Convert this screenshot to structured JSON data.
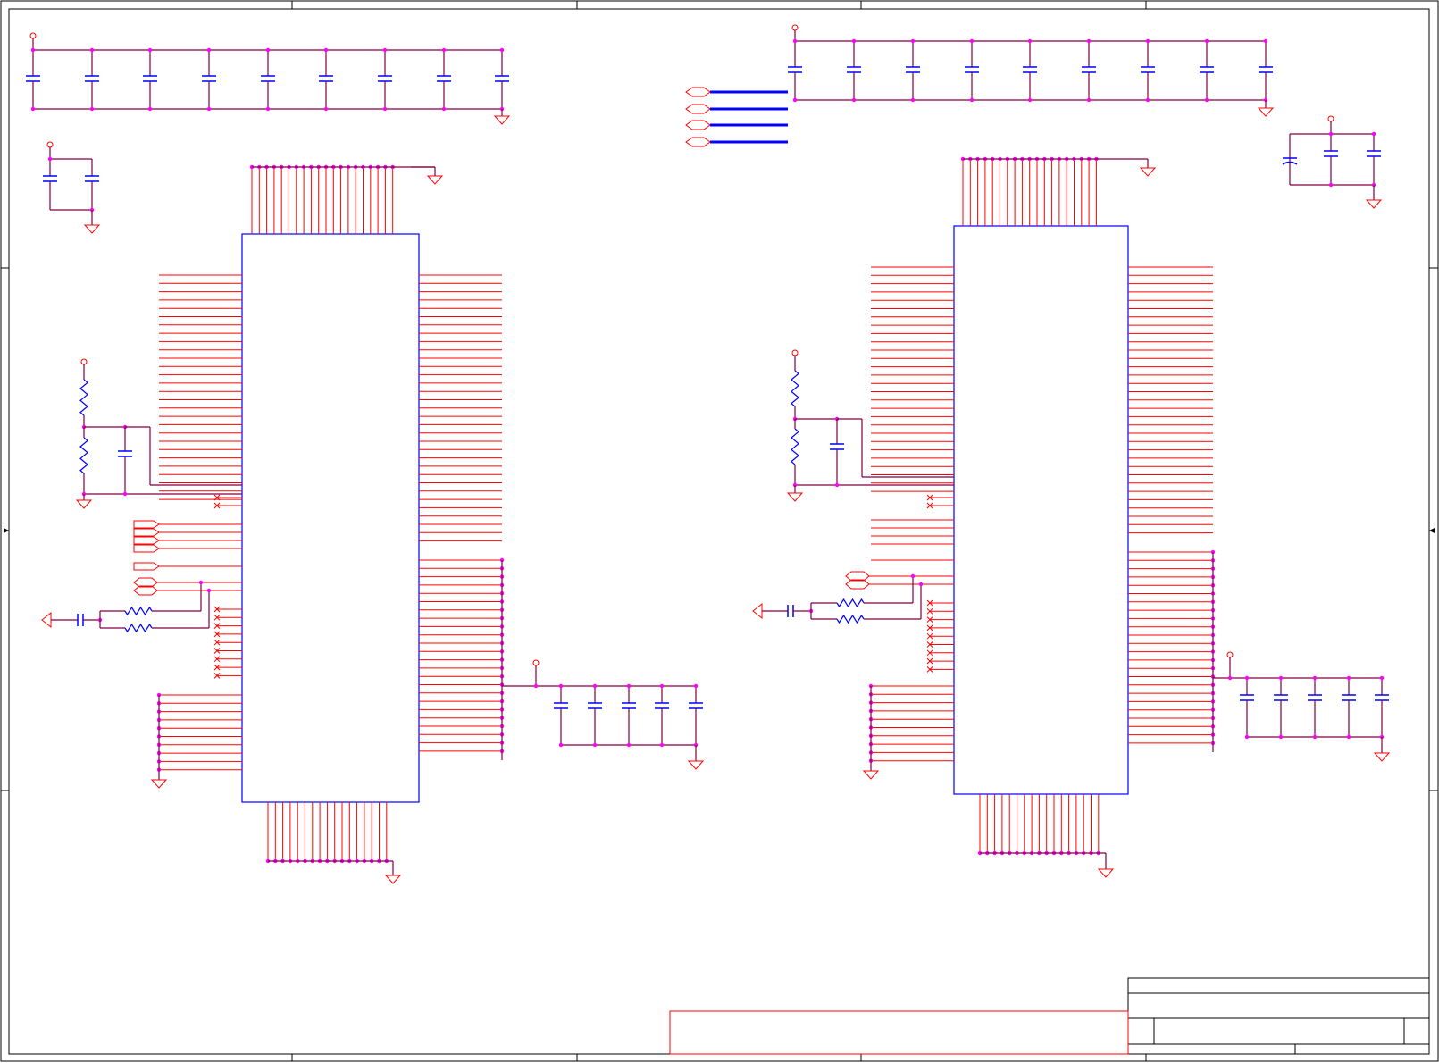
{
  "sheet": {
    "title": "",
    "border_color": "#000000"
  },
  "colors": {
    "wire": "#800040",
    "pin": "#ff0000",
    "junction": "#ff00ff",
    "component": "#0000ff",
    "frame": "#000000"
  },
  "components": {
    "left_chip": {
      "refdes": "",
      "value": ""
    },
    "right_chip": {
      "refdes": "",
      "value": ""
    }
  },
  "title_block": {
    "title": "",
    "doc_number": "",
    "revision": ""
  },
  "nets": {
    "offpage_connectors": 4
  }
}
